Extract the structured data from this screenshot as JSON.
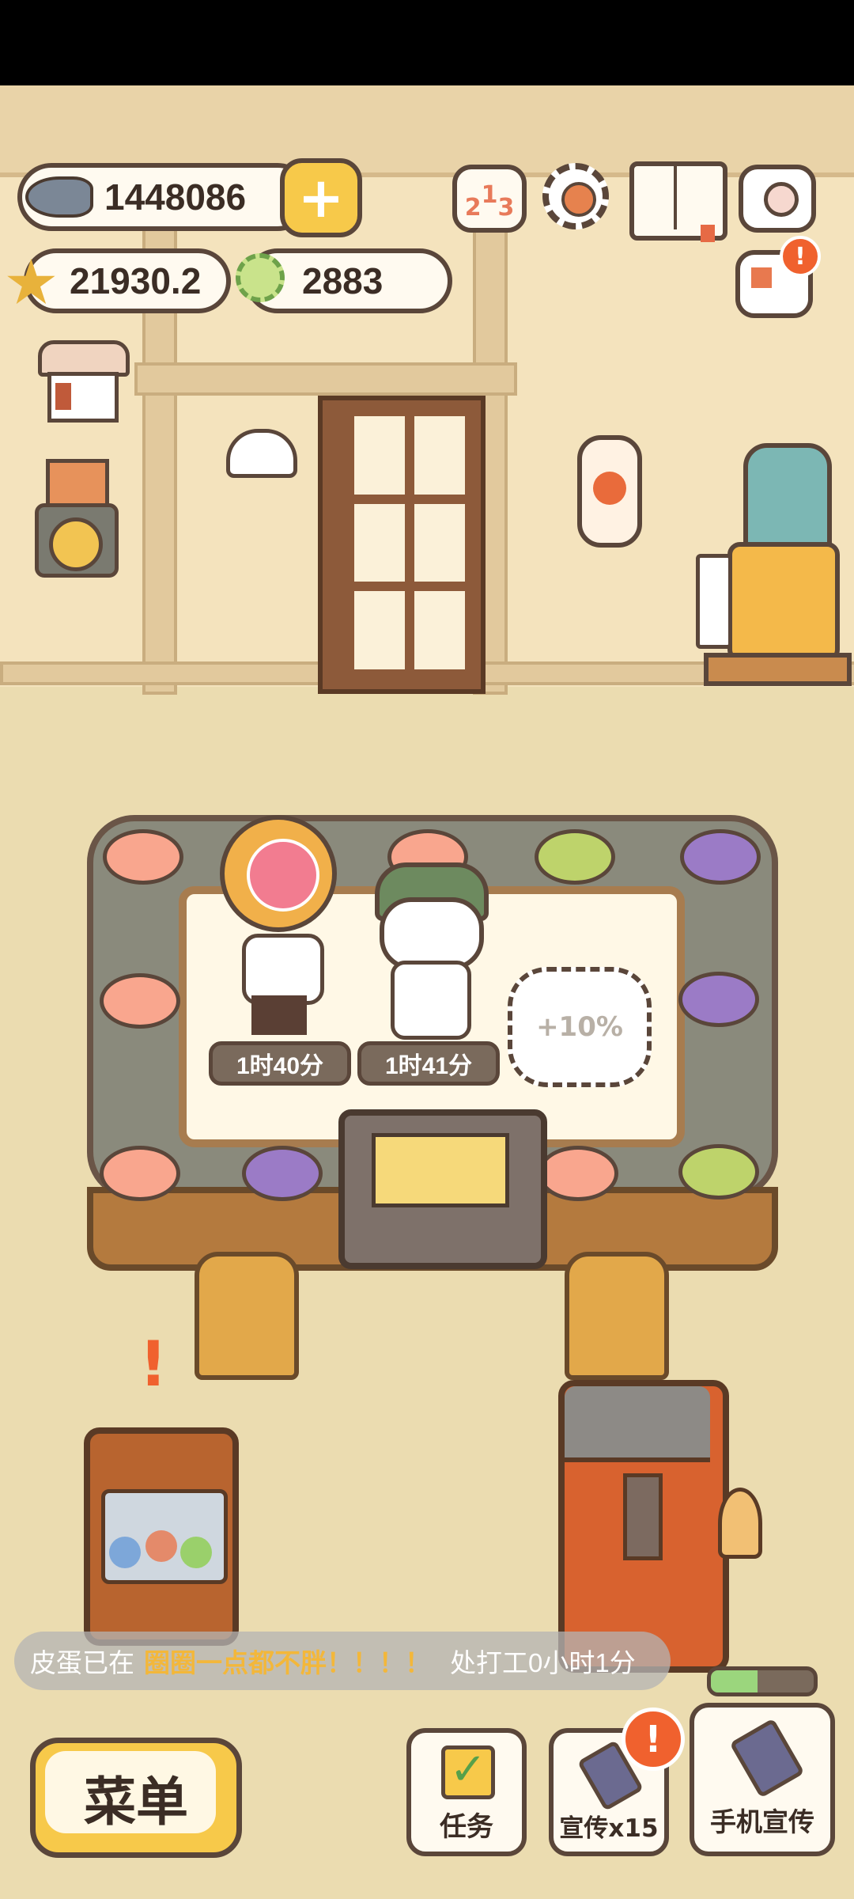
{
  "currency": {
    "fish": "1448086",
    "stars": "21930.2",
    "coins": "2883"
  },
  "chefs": [
    {
      "timer": "1时40分"
    },
    {
      "timer": "1时41分"
    }
  ],
  "empty_slot": {
    "bonus": "+10%"
  },
  "notice": {
    "prefix": "皮蛋已在",
    "highlight": "圈圈一点都不胖！！！！",
    "suffix": "处打工0小时1分"
  },
  "bottom": {
    "menu_label": "菜单",
    "task_label": "任务",
    "promo_label": "宣传x15",
    "phone_promo_label": "手机宣传"
  },
  "colors": {
    "accent": "#f7c94a",
    "highlight_text": "#f3b73a",
    "timer_bg": "#7a6a5c",
    "alert": "#f0612e"
  }
}
